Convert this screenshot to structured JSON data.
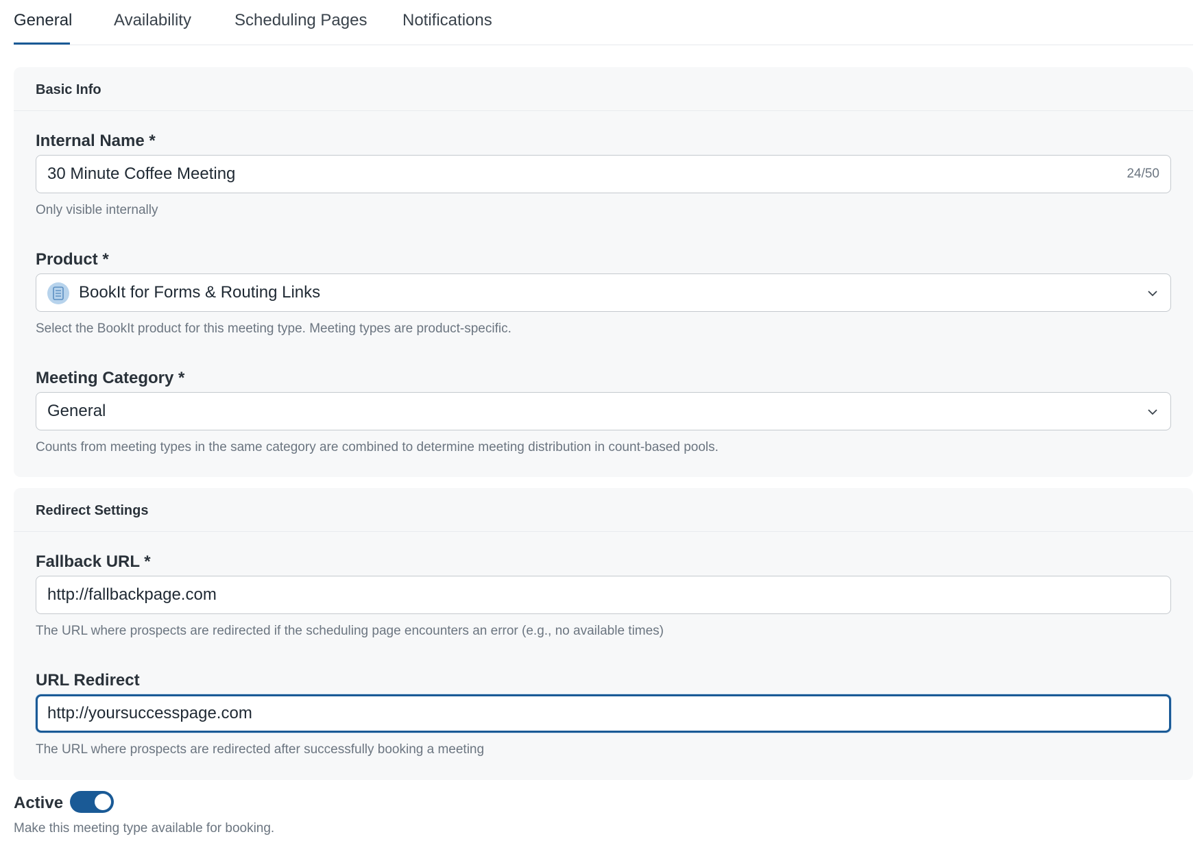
{
  "tabs": [
    {
      "label": "General",
      "active": true
    },
    {
      "label": "Availability",
      "active": false
    },
    {
      "label": "Scheduling Pages",
      "active": false
    },
    {
      "label": "Notifications",
      "active": false
    }
  ],
  "basic_info": {
    "title": "Basic Info",
    "internal_name": {
      "label": "Internal Name *",
      "value": "30 Minute Coffee Meeting",
      "counter": "24/50",
      "help": "Only visible internally"
    },
    "product": {
      "label": "Product *",
      "value": "BookIt for Forms & Routing Links",
      "icon": "document-icon",
      "help": "Select the BookIt product for this meeting type. Meeting types are product-specific."
    },
    "meeting_category": {
      "label": "Meeting Category *",
      "value": "General",
      "help": "Counts from meeting types in the same category are combined to determine meeting distribution in count-based pools."
    }
  },
  "redirect_settings": {
    "title": "Redirect Settings",
    "fallback_url": {
      "label": "Fallback URL *",
      "value": "http://fallbackpage.com",
      "help": "The URL where prospects are redirected if the scheduling page encounters an error (e.g., no available times)"
    },
    "url_redirect": {
      "label": "URL Redirect",
      "value": "http://yoursuccesspage.com",
      "help": "The URL where prospects are redirected after successfully booking a meeting"
    }
  },
  "active": {
    "label": "Active",
    "enabled": true,
    "help": "Make this meeting type available for booking."
  },
  "colors": {
    "accent": "#1a5a96",
    "section_bg": "#f7f8f9",
    "help_text": "#6b7580"
  }
}
